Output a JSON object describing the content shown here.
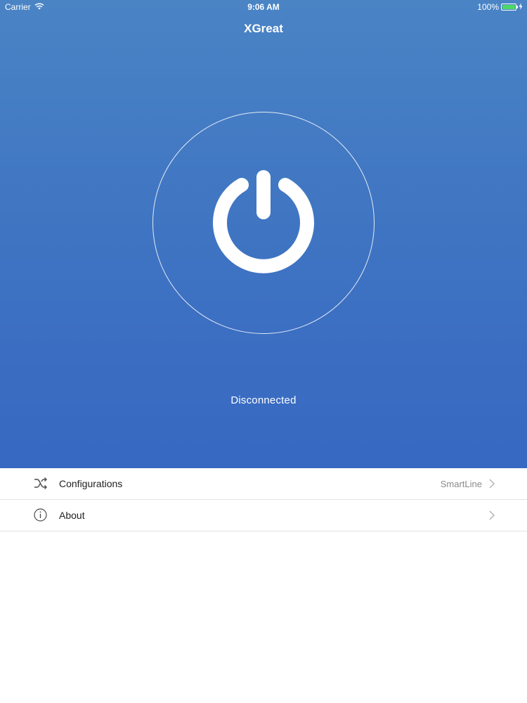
{
  "status_bar": {
    "carrier": "Carrier",
    "time": "9:06 AM",
    "battery": "100%",
    "battery_level": 1.0,
    "icons": [
      "wifi-icon",
      "battery-icon",
      "charging-icon"
    ]
  },
  "header": {
    "title": "XGreat"
  },
  "power": {
    "icon": "power-icon",
    "status": "Disconnected"
  },
  "menu": {
    "items": [
      {
        "icon": "shuffle-icon",
        "label": "Configurations",
        "detail": "SmartLine"
      },
      {
        "icon": "info-icon",
        "label": "About",
        "detail": ""
      }
    ]
  },
  "colors": {
    "gradient_top": "#4a84c5",
    "gradient_bottom": "#3768c2",
    "battery_green": "#4cd964",
    "detail_gray": "#8a8a8e"
  }
}
